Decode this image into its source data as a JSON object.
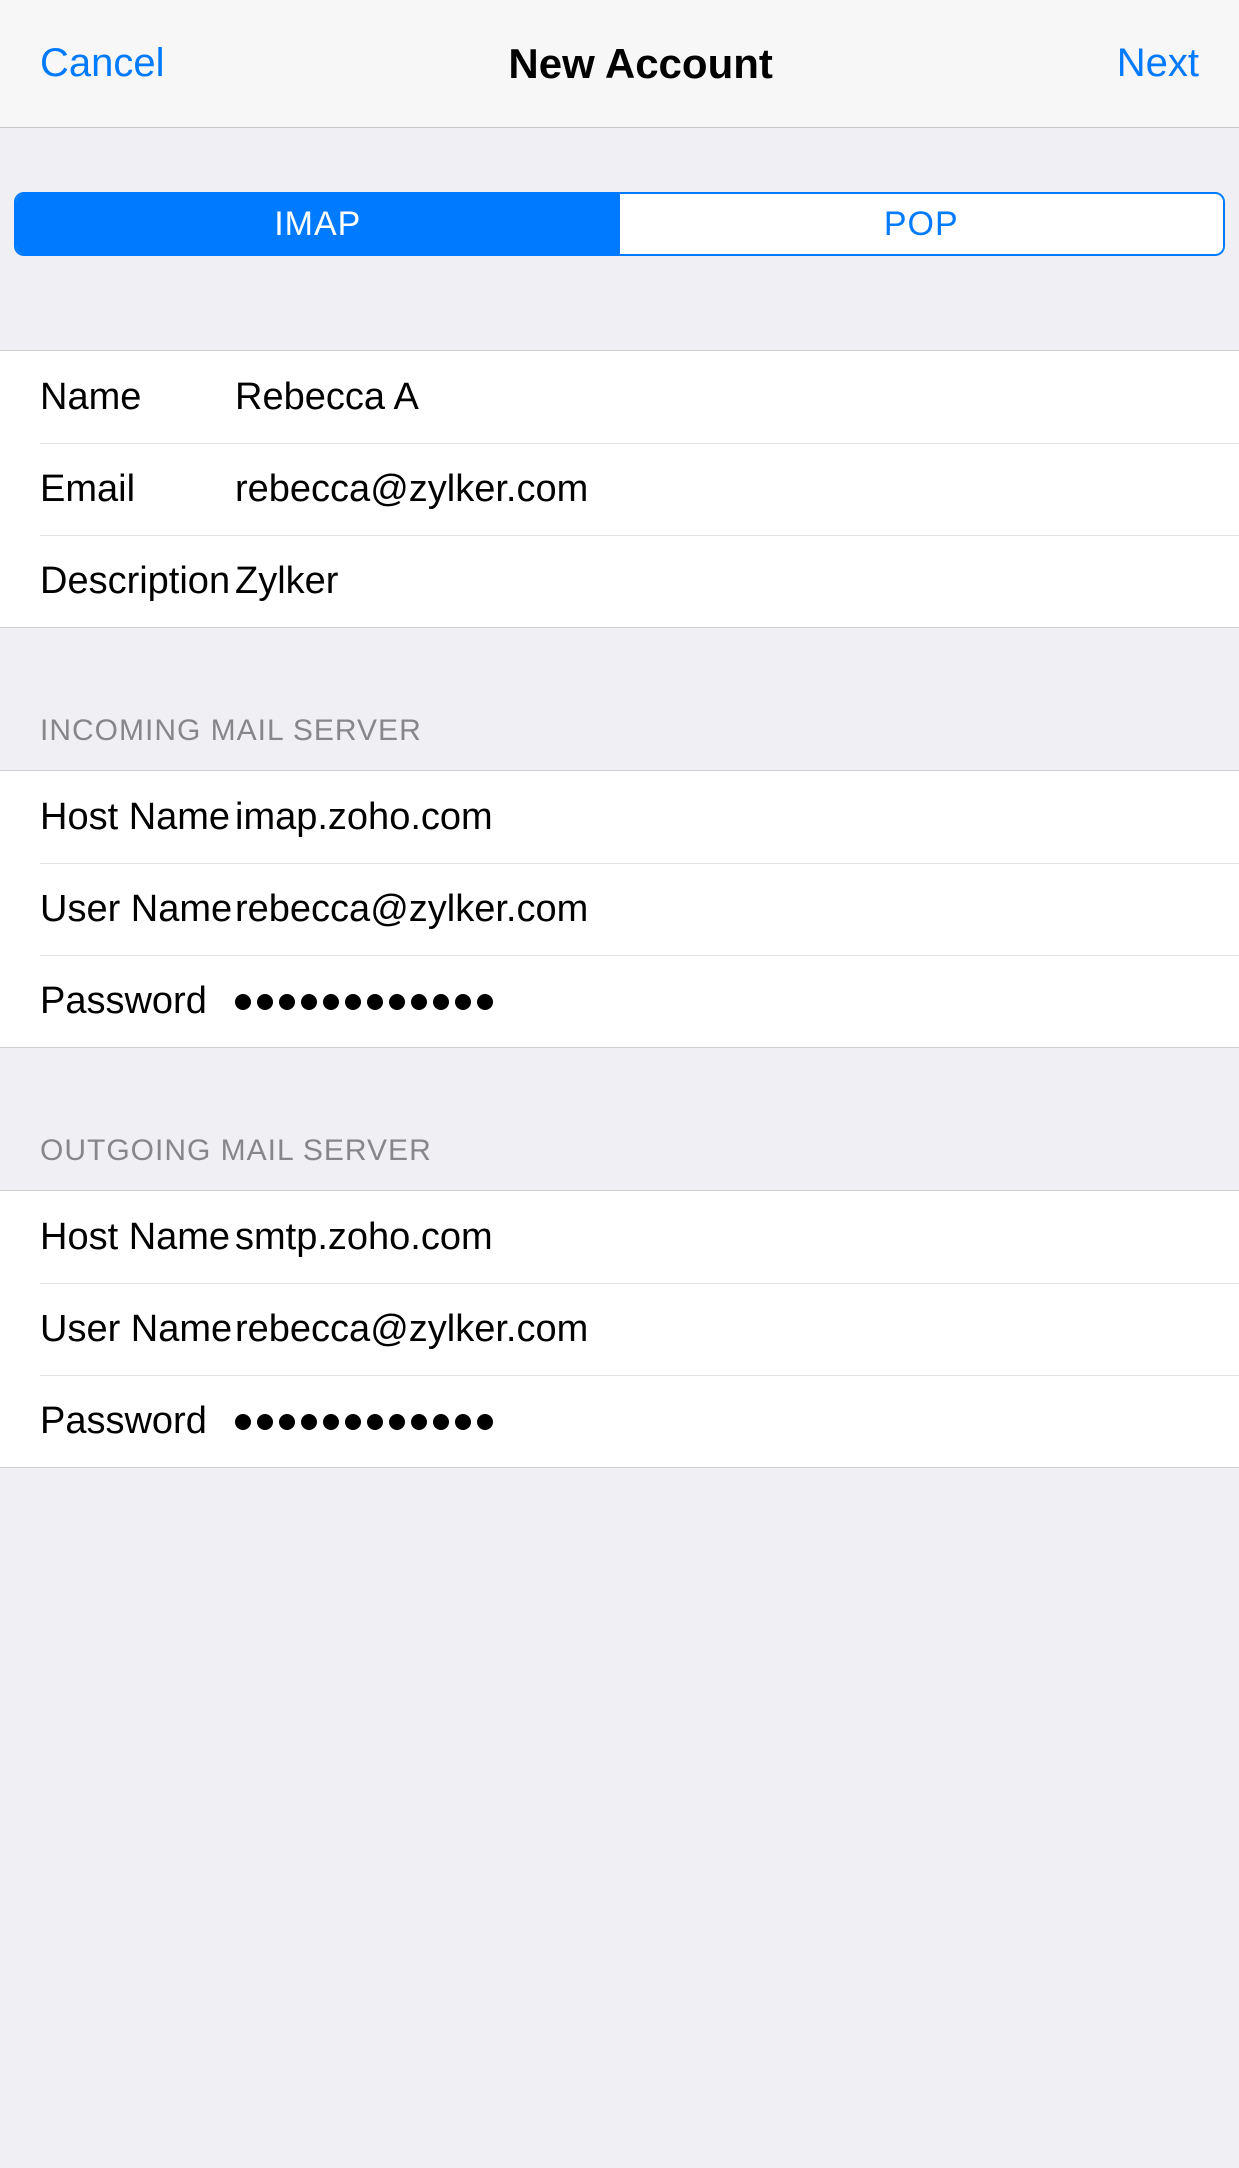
{
  "header": {
    "cancel_label": "Cancel",
    "title": "New Account",
    "next_label": "Next"
  },
  "segmented": {
    "imap_label": "IMAP",
    "pop_label": "POP",
    "selected": "imap"
  },
  "account": {
    "name_label": "Name",
    "name_value": "Rebecca A",
    "email_label": "Email",
    "email_value": "rebecca@zylker.com",
    "description_label": "Description",
    "description_value": "Zylker"
  },
  "incoming": {
    "section_title": "INCOMING MAIL SERVER",
    "host_label": "Host Name",
    "host_value": "imap.zoho.com",
    "user_label": "User Name",
    "user_value": "rebecca@zylker.com",
    "password_label": "Password",
    "password_value": "●●●●●●●●●●●●"
  },
  "outgoing": {
    "section_title": "OUTGOING MAIL SERVER",
    "host_label": "Host Name",
    "host_value": "smtp.zoho.com",
    "user_label": "User Name",
    "user_value": "rebecca@zylker.com",
    "password_label": "Password",
    "password_value": "●●●●●●●●●●●●"
  }
}
